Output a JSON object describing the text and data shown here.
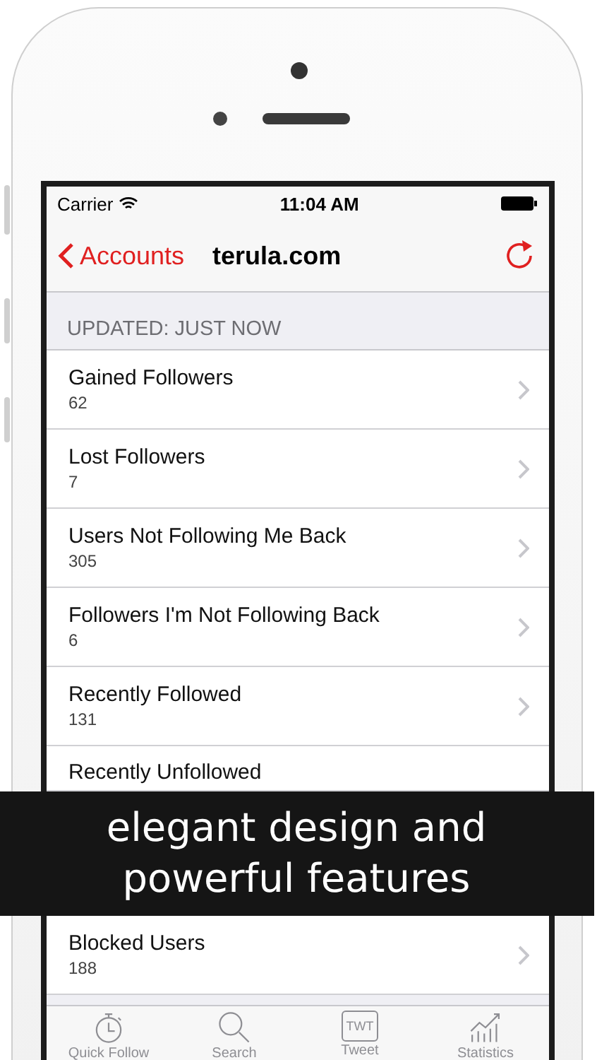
{
  "status_bar": {
    "carrier": "Carrier",
    "time": "11:04 AM"
  },
  "nav_bar": {
    "back": "Accounts",
    "title": "terula.com"
  },
  "section_header": "UPDATED: JUST NOW",
  "rows_above_caption": [
    {
      "title": "Gained Followers",
      "count": "62"
    },
    {
      "title": "Lost Followers",
      "count": "7"
    },
    {
      "title": "Users Not Following Me Back",
      "count": "305"
    },
    {
      "title": "Followers I'm Not Following Back",
      "count": "6"
    },
    {
      "title": "Recently Followed",
      "count": "131"
    },
    {
      "title": "Recently Unfollowed"
    }
  ],
  "banner": {
    "lines": [
      "elegant design and",
      "powerful features"
    ]
  },
  "rows_below_caption": [
    {
      "title": "Blocked Users",
      "count": "188"
    }
  ],
  "tab_bar": [
    {
      "kind": "stopwatch",
      "label": "Quick Follow"
    },
    {
      "kind": "search",
      "label": "Search"
    },
    {
      "kind": "bubble",
      "label": "Tweet",
      "icon_text": "TWT"
    },
    {
      "kind": "chart",
      "label": "Statistics"
    }
  ]
}
